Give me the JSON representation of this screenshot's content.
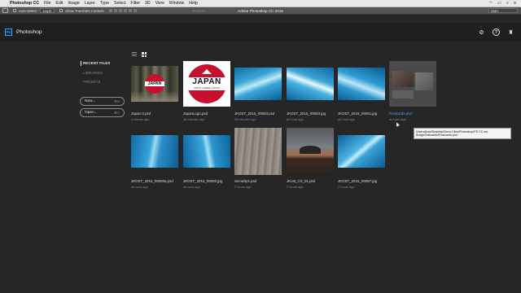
{
  "menubar": {
    "app_name": "Photoshop CC",
    "items": [
      "File",
      "Edit",
      "Image",
      "Layer",
      "Type",
      "Select",
      "Filter",
      "3D",
      "View",
      "Window",
      "Help"
    ],
    "right_text": "Start"
  },
  "options_bar": {
    "auto_select_label": "Auto-Select:",
    "auto_select_value": "Layer",
    "transform_label": "Show Transform Controls",
    "mode_3d": "3D Mode:",
    "doc_title": "Adobe Photoshop CC 2015",
    "workspace": "Start"
  },
  "header": {
    "logo_text": "Ps",
    "title": "Photoshop",
    "icons": [
      "gear-icon",
      "help-icon",
      "gift-icon"
    ]
  },
  "leftnav": {
    "items": [
      {
        "label": "RECENT FILES",
        "active": true
      },
      {
        "label": "LIBRARIES",
        "active": false
      },
      {
        "label": "PRESETS",
        "active": false
      }
    ],
    "new_label": "New...",
    "new_shortcut": "⌘N",
    "open_label": "Open...",
    "open_shortcut": "⌘O"
  },
  "files": [
    {
      "name": "Japan-3.psd",
      "time": "a minute ago"
    },
    {
      "name": "JapanLogo.psd",
      "time": "18 minutes ago"
    },
    {
      "name": "JKOST_2015_09083.psd",
      "time": "36 minutes ago"
    },
    {
      "name": "JKOST_2015_09083.jpg",
      "time": "an hour ago"
    },
    {
      "name": "JKOST_2015_09091.jpg",
      "time": "an hour ago"
    },
    {
      "name": "Postcards.psd",
      "time": "an hour ago"
    },
    {
      "name": "JKOST_2015_09050a.psd",
      "time": "an hour ago"
    },
    {
      "name": "JKOST_2015_09050.jpg",
      "time": "an hour ago"
    },
    {
      "name": "SecurityX.psd",
      "time": "2 hours ago"
    },
    {
      "name": "JKost_CS_01.psd",
      "time": "2 hours ago"
    },
    {
      "name": "JKOST_2015_09067.jpg",
      "time": "2 hours ago"
    }
  ],
  "japan_logo": {
    "word": "JAPAN",
    "subtitle": "TOKYO • OSAKA • KYOTO"
  },
  "tooltip": {
    "text": "/Users/jkost/Desktop/Demo Files/Photoshop/PS CC.wa Bridge/Artboards/Postcards.psd"
  },
  "colors": {
    "background": "#262626",
    "header": "#1f1f1f",
    "accent": "#4da3ff",
    "ps_blue": "#31a8ff"
  }
}
